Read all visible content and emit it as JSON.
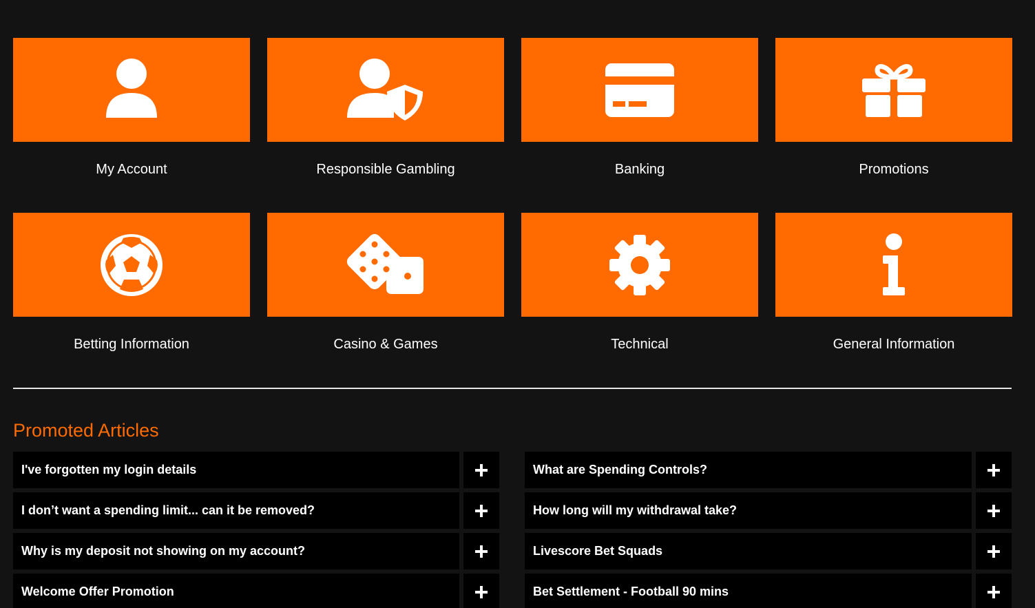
{
  "theme": {
    "accent": "#ff6b00",
    "background": "#131313",
    "row_bg": "#000000",
    "text": "#ffffff"
  },
  "categories": [
    {
      "label": "My Account",
      "icon": "user-icon"
    },
    {
      "label": "Responsible Gambling",
      "icon": "user-shield-icon"
    },
    {
      "label": "Banking",
      "icon": "credit-card-icon"
    },
    {
      "label": "Promotions",
      "icon": "gift-icon"
    },
    {
      "label": "Betting Information",
      "icon": "football-icon"
    },
    {
      "label": "Casino & Games",
      "icon": "dice-icon"
    },
    {
      "label": "Technical",
      "icon": "gear-icon"
    },
    {
      "label": "General Information",
      "icon": "info-icon"
    }
  ],
  "promoted": {
    "title": "Promoted Articles",
    "toggle_icon": "plus-icon",
    "articles": [
      "I've forgotten my login details",
      "What are Spending Controls?",
      "I don’t want a spending limit... can it be removed?",
      "How long will my withdrawal take?",
      "Why is my deposit not showing on my account?",
      "Livescore Bet Squads",
      "Welcome Offer Promotion",
      "Bet Settlement - Football 90 mins"
    ]
  }
}
